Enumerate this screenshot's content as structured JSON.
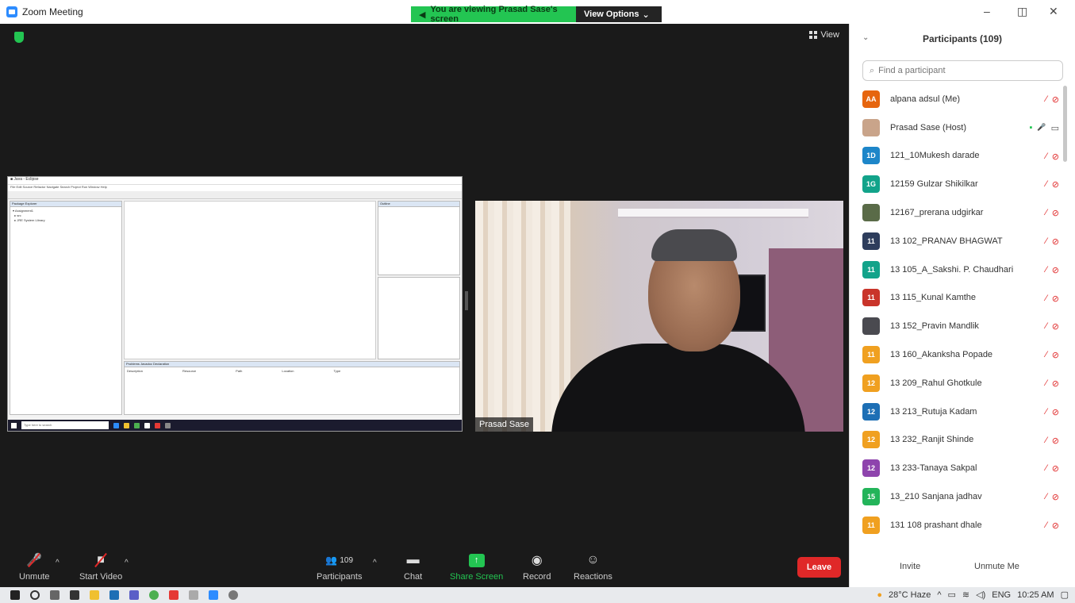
{
  "window": {
    "title": "Zoom Meeting"
  },
  "banner": {
    "viewing": "You are viewing Prasad Sase's screen",
    "view_options": "View Options"
  },
  "stage": {
    "view_label": "View",
    "speaker_name": "Prasad Sase"
  },
  "shared_screen": {
    "taskbar_search": "Type here to search",
    "package_explorer": "Package Explorer",
    "outline": "Outline",
    "problems_tabs": "Problems  Javadoc  Declaration",
    "problems_columns": [
      "Description",
      "Resource",
      "Path",
      "Location",
      "Type"
    ]
  },
  "toolbar": {
    "unmute": "Unmute",
    "start_video": "Start Video",
    "participants": "Participants",
    "participants_count": "109",
    "chat": "Chat",
    "share_screen": "Share Screen",
    "record": "Record",
    "reactions": "Reactions",
    "leave": "Leave"
  },
  "panel": {
    "title": "Participants (109)",
    "search_placeholder": "Find a participant",
    "invite": "Invite",
    "unmute_me": "Unmute Me",
    "participants": [
      {
        "initials": "AA",
        "name": "alpana adsul (Me)",
        "color": "#e6650e",
        "photo": false
      },
      {
        "initials": "",
        "name": "Prasad Sase (Host)",
        "color": "#c9a48a",
        "photo": true,
        "host": true
      },
      {
        "initials": "1D",
        "name": "121_10Mukesh darade",
        "color": "#1d86c9",
        "photo": false
      },
      {
        "initials": "1G",
        "name": "12159 Gulzar Shikilkar",
        "color": "#12a38a",
        "photo": false
      },
      {
        "initials": "",
        "name": "12167_prerana udgirkar",
        "color": "#5a6b48",
        "photo": true
      },
      {
        "initials": "11",
        "name": "13 102_PRANAV BHAGWAT",
        "color": "#2e3d5c",
        "photo": false
      },
      {
        "initials": "11",
        "name": "13 105_A_Sakshi. P. Chaudhari",
        "color": "#12a38a",
        "photo": false
      },
      {
        "initials": "11",
        "name": "13 115_Kunal Kamthe",
        "color": "#c9342a",
        "photo": false
      },
      {
        "initials": "",
        "name": "13 152_Pravin Mandlik",
        "color": "#4a4a50",
        "photo": true
      },
      {
        "initials": "11",
        "name": "13 160_Akanksha Popade",
        "color": "#f0a020",
        "photo": false
      },
      {
        "initials": "12",
        "name": "13 209_Rahul Ghotkule",
        "color": "#f0a020",
        "photo": false
      },
      {
        "initials": "12",
        "name": "13 213_Rutuja Kadam",
        "color": "#1d6fb5",
        "photo": false
      },
      {
        "initials": "12",
        "name": "13 232_Ranjit Shinde",
        "color": "#f0a020",
        "photo": false
      },
      {
        "initials": "12",
        "name": "13 233-Tanaya Sakpal",
        "color": "#8e44ad",
        "photo": false
      },
      {
        "initials": "15",
        "name": "13_210 Sanjana jadhav",
        "color": "#23b45a",
        "photo": false
      },
      {
        "initials": "11",
        "name": "131 108 prashant dhale",
        "color": "#f0a020",
        "photo": false
      }
    ]
  },
  "taskbar": {
    "weather": "28°C Haze",
    "lang": "ENG",
    "time": "10:25 AM"
  }
}
